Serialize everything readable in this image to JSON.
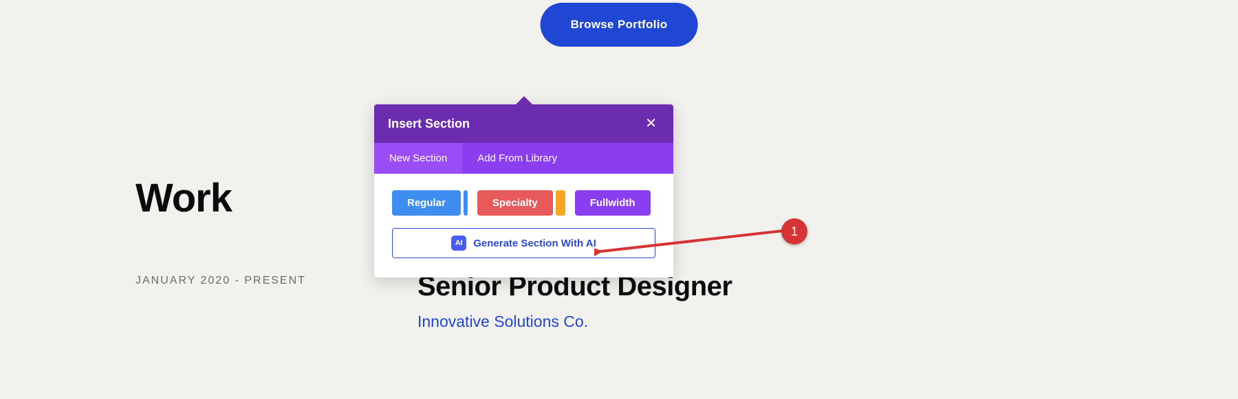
{
  "hero": {
    "browse_label": "Browse Portfolio"
  },
  "work": {
    "heading": "Work",
    "date_range": "JANUARY 2020 - PRESENT",
    "job_title": "Senior Product Designer",
    "company": "Innovative Solutions Co."
  },
  "popup": {
    "title": "Insert Section",
    "tabs": {
      "new": "New Section",
      "library": "Add From Library"
    },
    "types": {
      "regular": "Regular",
      "specialty": "Specialty",
      "fullwidth": "Fullwidth"
    },
    "ai": {
      "icon": "AI",
      "label": "Generate Section With AI"
    }
  },
  "annotation": {
    "number": "1"
  }
}
